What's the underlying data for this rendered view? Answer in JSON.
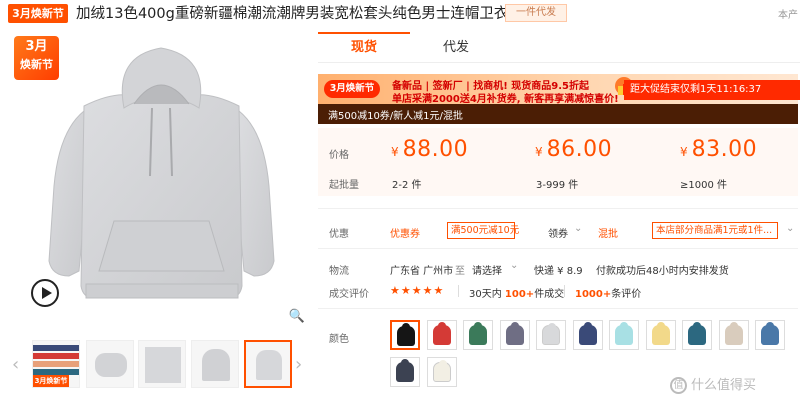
{
  "product": {
    "title_badge": "3月焕新节",
    "title": "加绒13色400g重磅新疆棉潮流潮牌男装宽松套头纯色男士连帽卫衣",
    "title_tag": "一件代发",
    "title_right": "本产"
  },
  "gallery": {
    "promo_badge": {
      "line1": "3月",
      "line2": "焕新节"
    },
    "thumb_badge": "3月焕新节",
    "left_arrow": "‹",
    "right_arrow": "›",
    "zoom_icon": "🔍"
  },
  "tabs": [
    {
      "label": "现货",
      "active": true
    },
    {
      "label": "代发",
      "active": false
    }
  ],
  "banner": {
    "badge": "3月焕新节",
    "line1": "备新品 | 签新厂 | 找商机!  现货商品9.5折起",
    "line2": "单店采满2000送4月补货券, 新客再享满减惊喜价!",
    "countdown": "距大促结束仅剩1天11:16:37"
  },
  "promo_strip": "满500减10券/新人减1元/混批",
  "price": {
    "price_label": "价格",
    "moq_label": "起批量",
    "currency": "¥",
    "tiers": [
      {
        "price": "88.00",
        "moq": "2-2 件"
      },
      {
        "price": "86.00",
        "moq": "3-999 件"
      },
      {
        "price": "83.00",
        "moq": "≥1000 件"
      }
    ]
  },
  "coupon": {
    "label": "优惠",
    "coupon_link": "优惠券",
    "chip1": "满500元减10元",
    "receive": "领券",
    "mix": "混批",
    "chip2": "本店部分商品满1元或1件..."
  },
  "logistics": {
    "label": "物流",
    "origin": "广东省 广州市",
    "to": "至",
    "dest": "请选择",
    "express": "快递 ¥ 8.9",
    "promise": "付款成功后48小时内安排发货"
  },
  "rating": {
    "label": "成交评价",
    "stars": "★★★★★",
    "sales_prefix": "30天内",
    "sales_count": "100+",
    "sales_suffix": "件成交",
    "reviews_count": "1000+",
    "reviews_suffix": "条评价"
  },
  "colors": {
    "label": "颜色",
    "swatches": [
      "#151515",
      "#d43a36",
      "#3b7a5a",
      "#6f6e84",
      "#d8d9db",
      "#3a4a78",
      "#a8e0e4",
      "#f2d98a",
      "#2c6880",
      "#d9ccbd",
      "#4a78a8",
      "#3c4252",
      "#f2efe4"
    ]
  },
  "watermark": {
    "icon": "值",
    "text": "什么值得买"
  },
  "theme": {
    "accent": "#ff5000",
    "dark_strip": "#4b1e05",
    "price_bg": "#fff8f4"
  }
}
